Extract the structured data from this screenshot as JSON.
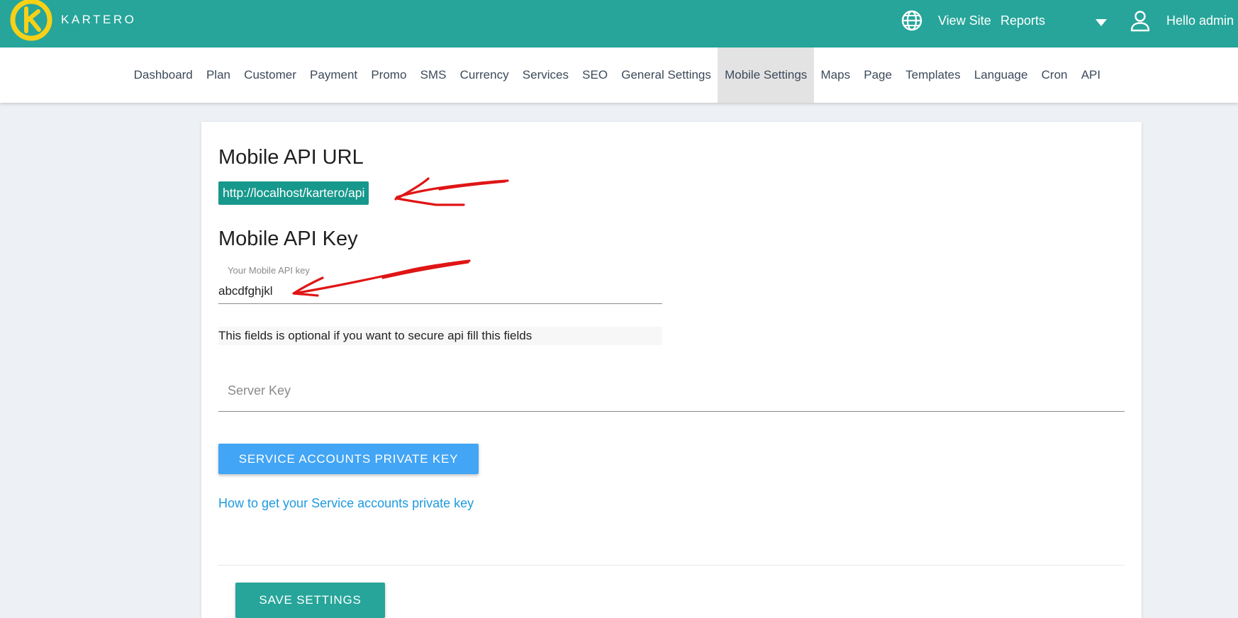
{
  "header": {
    "brand": "KARTERO",
    "links": {
      "view_site": "View Site",
      "reports": "Reports",
      "greeting": "Hello admin"
    },
    "icons": {
      "globe": "globe-icon",
      "caret": "caret-down-icon",
      "user": "user-icon"
    },
    "colors": {
      "bar": "#27a59a",
      "logo": "#f7d117"
    }
  },
  "nav": {
    "items": [
      {
        "label": "Dashboard"
      },
      {
        "label": "Plan"
      },
      {
        "label": "Customer"
      },
      {
        "label": "Payment"
      },
      {
        "label": "Promo"
      },
      {
        "label": "SMS"
      },
      {
        "label": "Currency"
      },
      {
        "label": "Services"
      },
      {
        "label": "SEO"
      },
      {
        "label": "General Settings"
      },
      {
        "label": "Mobile Settings",
        "active": true
      },
      {
        "label": "Maps"
      },
      {
        "label": "Page"
      },
      {
        "label": "Templates"
      },
      {
        "label": "Language"
      },
      {
        "label": "Cron"
      },
      {
        "label": "API"
      }
    ]
  },
  "main": {
    "api_url_title": "Mobile API URL",
    "api_url": "http://localhost/kartero/api",
    "api_key_title": "Mobile API Key",
    "api_key_label": "Your Mobile API key",
    "api_key_value": "abcdfghjkl",
    "help_text": "This fields is optional if you want to secure api fill this fields",
    "server_key_placeholder": "Server Key",
    "private_key_button": "SERVICE ACCOUNTS PRIVATE KEY",
    "help_link": "How to get your Service accounts private key",
    "save_button": "SAVE SETTINGS"
  }
}
